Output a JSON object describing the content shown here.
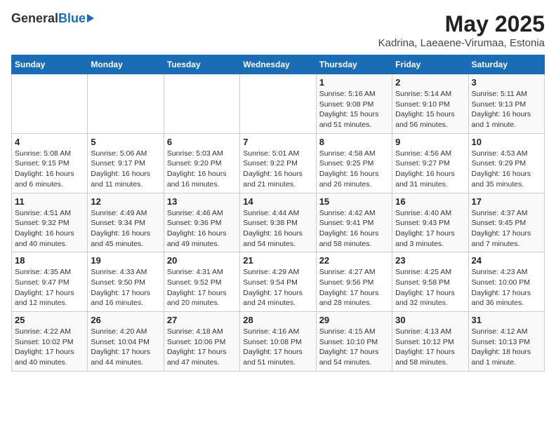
{
  "logo": {
    "general": "General",
    "blue": "Blue"
  },
  "title": "May 2025",
  "location": "Kadrina, Laeaene-Virumaa, Estonia",
  "days_of_week": [
    "Sunday",
    "Monday",
    "Tuesday",
    "Wednesday",
    "Thursday",
    "Friday",
    "Saturday"
  ],
  "weeks": [
    [
      {
        "day": "",
        "info": ""
      },
      {
        "day": "",
        "info": ""
      },
      {
        "day": "",
        "info": ""
      },
      {
        "day": "",
        "info": ""
      },
      {
        "day": "1",
        "info": "Sunrise: 5:16 AM\nSunset: 9:08 PM\nDaylight: 15 hours\nand 51 minutes."
      },
      {
        "day": "2",
        "info": "Sunrise: 5:14 AM\nSunset: 9:10 PM\nDaylight: 15 hours\nand 56 minutes."
      },
      {
        "day": "3",
        "info": "Sunrise: 5:11 AM\nSunset: 9:13 PM\nDaylight: 16 hours\nand 1 minute."
      }
    ],
    [
      {
        "day": "4",
        "info": "Sunrise: 5:08 AM\nSunset: 9:15 PM\nDaylight: 16 hours\nand 6 minutes."
      },
      {
        "day": "5",
        "info": "Sunrise: 5:06 AM\nSunset: 9:17 PM\nDaylight: 16 hours\nand 11 minutes."
      },
      {
        "day": "6",
        "info": "Sunrise: 5:03 AM\nSunset: 9:20 PM\nDaylight: 16 hours\nand 16 minutes."
      },
      {
        "day": "7",
        "info": "Sunrise: 5:01 AM\nSunset: 9:22 PM\nDaylight: 16 hours\nand 21 minutes."
      },
      {
        "day": "8",
        "info": "Sunrise: 4:58 AM\nSunset: 9:25 PM\nDaylight: 16 hours\nand 26 minutes."
      },
      {
        "day": "9",
        "info": "Sunrise: 4:56 AM\nSunset: 9:27 PM\nDaylight: 16 hours\nand 31 minutes."
      },
      {
        "day": "10",
        "info": "Sunrise: 4:53 AM\nSunset: 9:29 PM\nDaylight: 16 hours\nand 35 minutes."
      }
    ],
    [
      {
        "day": "11",
        "info": "Sunrise: 4:51 AM\nSunset: 9:32 PM\nDaylight: 16 hours\nand 40 minutes."
      },
      {
        "day": "12",
        "info": "Sunrise: 4:49 AM\nSunset: 9:34 PM\nDaylight: 16 hours\nand 45 minutes."
      },
      {
        "day": "13",
        "info": "Sunrise: 4:46 AM\nSunset: 9:36 PM\nDaylight: 16 hours\nand 49 minutes."
      },
      {
        "day": "14",
        "info": "Sunrise: 4:44 AM\nSunset: 9:38 PM\nDaylight: 16 hours\nand 54 minutes."
      },
      {
        "day": "15",
        "info": "Sunrise: 4:42 AM\nSunset: 9:41 PM\nDaylight: 16 hours\nand 58 minutes."
      },
      {
        "day": "16",
        "info": "Sunrise: 4:40 AM\nSunset: 9:43 PM\nDaylight: 17 hours\nand 3 minutes."
      },
      {
        "day": "17",
        "info": "Sunrise: 4:37 AM\nSunset: 9:45 PM\nDaylight: 17 hours\nand 7 minutes."
      }
    ],
    [
      {
        "day": "18",
        "info": "Sunrise: 4:35 AM\nSunset: 9:47 PM\nDaylight: 17 hours\nand 12 minutes."
      },
      {
        "day": "19",
        "info": "Sunrise: 4:33 AM\nSunset: 9:50 PM\nDaylight: 17 hours\nand 16 minutes."
      },
      {
        "day": "20",
        "info": "Sunrise: 4:31 AM\nSunset: 9:52 PM\nDaylight: 17 hours\nand 20 minutes."
      },
      {
        "day": "21",
        "info": "Sunrise: 4:29 AM\nSunset: 9:54 PM\nDaylight: 17 hours\nand 24 minutes."
      },
      {
        "day": "22",
        "info": "Sunrise: 4:27 AM\nSunset: 9:56 PM\nDaylight: 17 hours\nand 28 minutes."
      },
      {
        "day": "23",
        "info": "Sunrise: 4:25 AM\nSunset: 9:58 PM\nDaylight: 17 hours\nand 32 minutes."
      },
      {
        "day": "24",
        "info": "Sunrise: 4:23 AM\nSunset: 10:00 PM\nDaylight: 17 hours\nand 36 minutes."
      }
    ],
    [
      {
        "day": "25",
        "info": "Sunrise: 4:22 AM\nSunset: 10:02 PM\nDaylight: 17 hours\nand 40 minutes."
      },
      {
        "day": "26",
        "info": "Sunrise: 4:20 AM\nSunset: 10:04 PM\nDaylight: 17 hours\nand 44 minutes."
      },
      {
        "day": "27",
        "info": "Sunrise: 4:18 AM\nSunset: 10:06 PM\nDaylight: 17 hours\nand 47 minutes."
      },
      {
        "day": "28",
        "info": "Sunrise: 4:16 AM\nSunset: 10:08 PM\nDaylight: 17 hours\nand 51 minutes."
      },
      {
        "day": "29",
        "info": "Sunrise: 4:15 AM\nSunset: 10:10 PM\nDaylight: 17 hours\nand 54 minutes."
      },
      {
        "day": "30",
        "info": "Sunrise: 4:13 AM\nSunset: 10:12 PM\nDaylight: 17 hours\nand 58 minutes."
      },
      {
        "day": "31",
        "info": "Sunrise: 4:12 AM\nSunset: 10:13 PM\nDaylight: 18 hours\nand 1 minute."
      }
    ]
  ]
}
